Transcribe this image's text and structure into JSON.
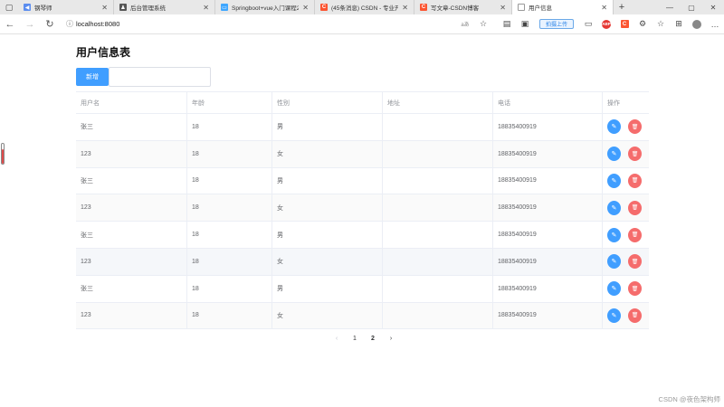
{
  "browser": {
    "tabs": [
      {
        "title": "钢琴师",
        "color": "#5b8def",
        "icon": "speaker-icon"
      },
      {
        "title": "后台管理系统",
        "color": "#555555",
        "icon": "person-icon"
      },
      {
        "title": "Springboot+vue入门课程2",
        "color": "#3ea6ff",
        "icon": "tv-icon"
      },
      {
        "title": "(45条消息) CSDN - 专业开发",
        "color": "#fc5531",
        "icon": "csdn-icon"
      },
      {
        "title": "写文章-CSDN博客",
        "color": "#fc5531",
        "icon": "csdn-icon"
      },
      {
        "title": "用户信息",
        "color": "#999999",
        "icon": "page-icon"
      }
    ],
    "url": "localhost:8080",
    "upload_label": "拍摄上传",
    "abp_label": "ABP"
  },
  "page": {
    "title": "用户信息表",
    "add_label": "新增"
  },
  "table": {
    "headers": {
      "name": "用户名",
      "age": "年龄",
      "sex": "性别",
      "address": "地址",
      "phone": "电话",
      "op": "操作"
    },
    "rows": [
      {
        "name": "张三",
        "age": "18",
        "sex": "男",
        "address": "",
        "phone": "18835400919"
      },
      {
        "name": "123",
        "age": "18",
        "sex": "女",
        "address": "",
        "phone": "18835400919"
      },
      {
        "name": "张三",
        "age": "18",
        "sex": "男",
        "address": "",
        "phone": "18835400919"
      },
      {
        "name": "123",
        "age": "18",
        "sex": "女",
        "address": "",
        "phone": "18835400919"
      },
      {
        "name": "张三",
        "age": "18",
        "sex": "男",
        "address": "",
        "phone": "18835400919"
      },
      {
        "name": "123",
        "age": "18",
        "sex": "女",
        "address": "",
        "phone": "18835400919"
      },
      {
        "name": "张三",
        "age": "18",
        "sex": "男",
        "address": "",
        "phone": "18835400919"
      },
      {
        "name": "123",
        "age": "18",
        "sex": "女",
        "address": "",
        "phone": "18835400919"
      }
    ]
  },
  "pagination": {
    "prev": "‹",
    "pages": [
      "1",
      "2"
    ],
    "current": "2",
    "next": "›"
  },
  "watermark": "CSDN @夜色架构师",
  "colors": {
    "primary": "#409eff",
    "danger": "#f56c6c"
  }
}
